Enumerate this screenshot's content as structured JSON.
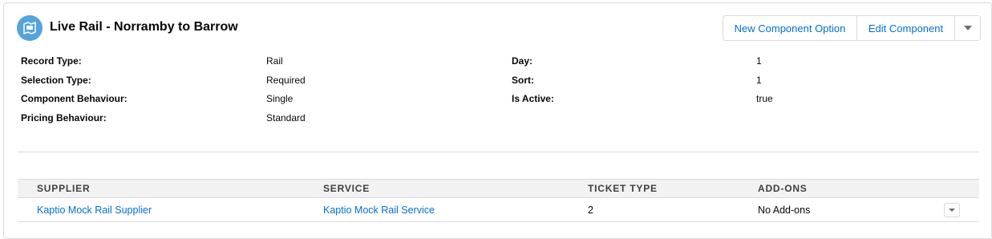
{
  "header": {
    "icon": "rail-icon",
    "title": "Live Rail - Norramby to Barrow"
  },
  "actions": {
    "new_option": "New Component Option",
    "edit": "Edit Component",
    "more_icon": "chevron-down-icon"
  },
  "details": {
    "left": [
      {
        "label": "Record Type:",
        "value": "Rail"
      },
      {
        "label": "Selection Type:",
        "value": "Required"
      },
      {
        "label": "Component Behaviour:",
        "value": "Single"
      },
      {
        "label": "Pricing Behaviour:",
        "value": "Standard"
      }
    ],
    "right": [
      {
        "label": "Day:",
        "value": "1"
      },
      {
        "label": "Sort:",
        "value": "1"
      },
      {
        "label": "Is Active:",
        "value": "true"
      }
    ]
  },
  "table": {
    "columns": [
      "SUPPLIER",
      "SERVICE",
      "TICKET TYPE",
      "ADD-ONS"
    ],
    "rows": [
      {
        "supplier": "Kaptio Mock Rail Supplier",
        "service": "Kaptio Mock Rail Service",
        "ticket_type": "2",
        "addons": "No Add-ons"
      }
    ]
  },
  "colors": {
    "accent": "#0070d2",
    "icon_bg": "#54a3dc",
    "header_bg": "#f3f2f2",
    "border": "#dddbda"
  }
}
